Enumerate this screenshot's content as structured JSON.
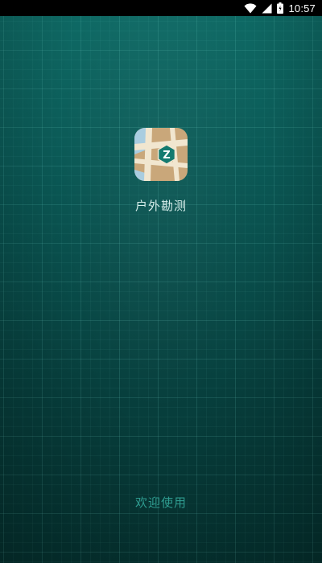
{
  "status_bar": {
    "time": "10:57",
    "icons": [
      "wifi-icon",
      "signal-icon",
      "battery-icon"
    ]
  },
  "splash": {
    "app_icon": "map-hexagon-z-icon",
    "icon_letter": "Z",
    "app_name": "户外勘测",
    "welcome_text": "欢迎使用"
  },
  "colors": {
    "background_top": "#0f6b66",
    "background_bottom": "#053331",
    "grid_line": "#78dcd2",
    "welcome_text": "#2f9c90",
    "icon_hexagon": "#137a6f"
  }
}
